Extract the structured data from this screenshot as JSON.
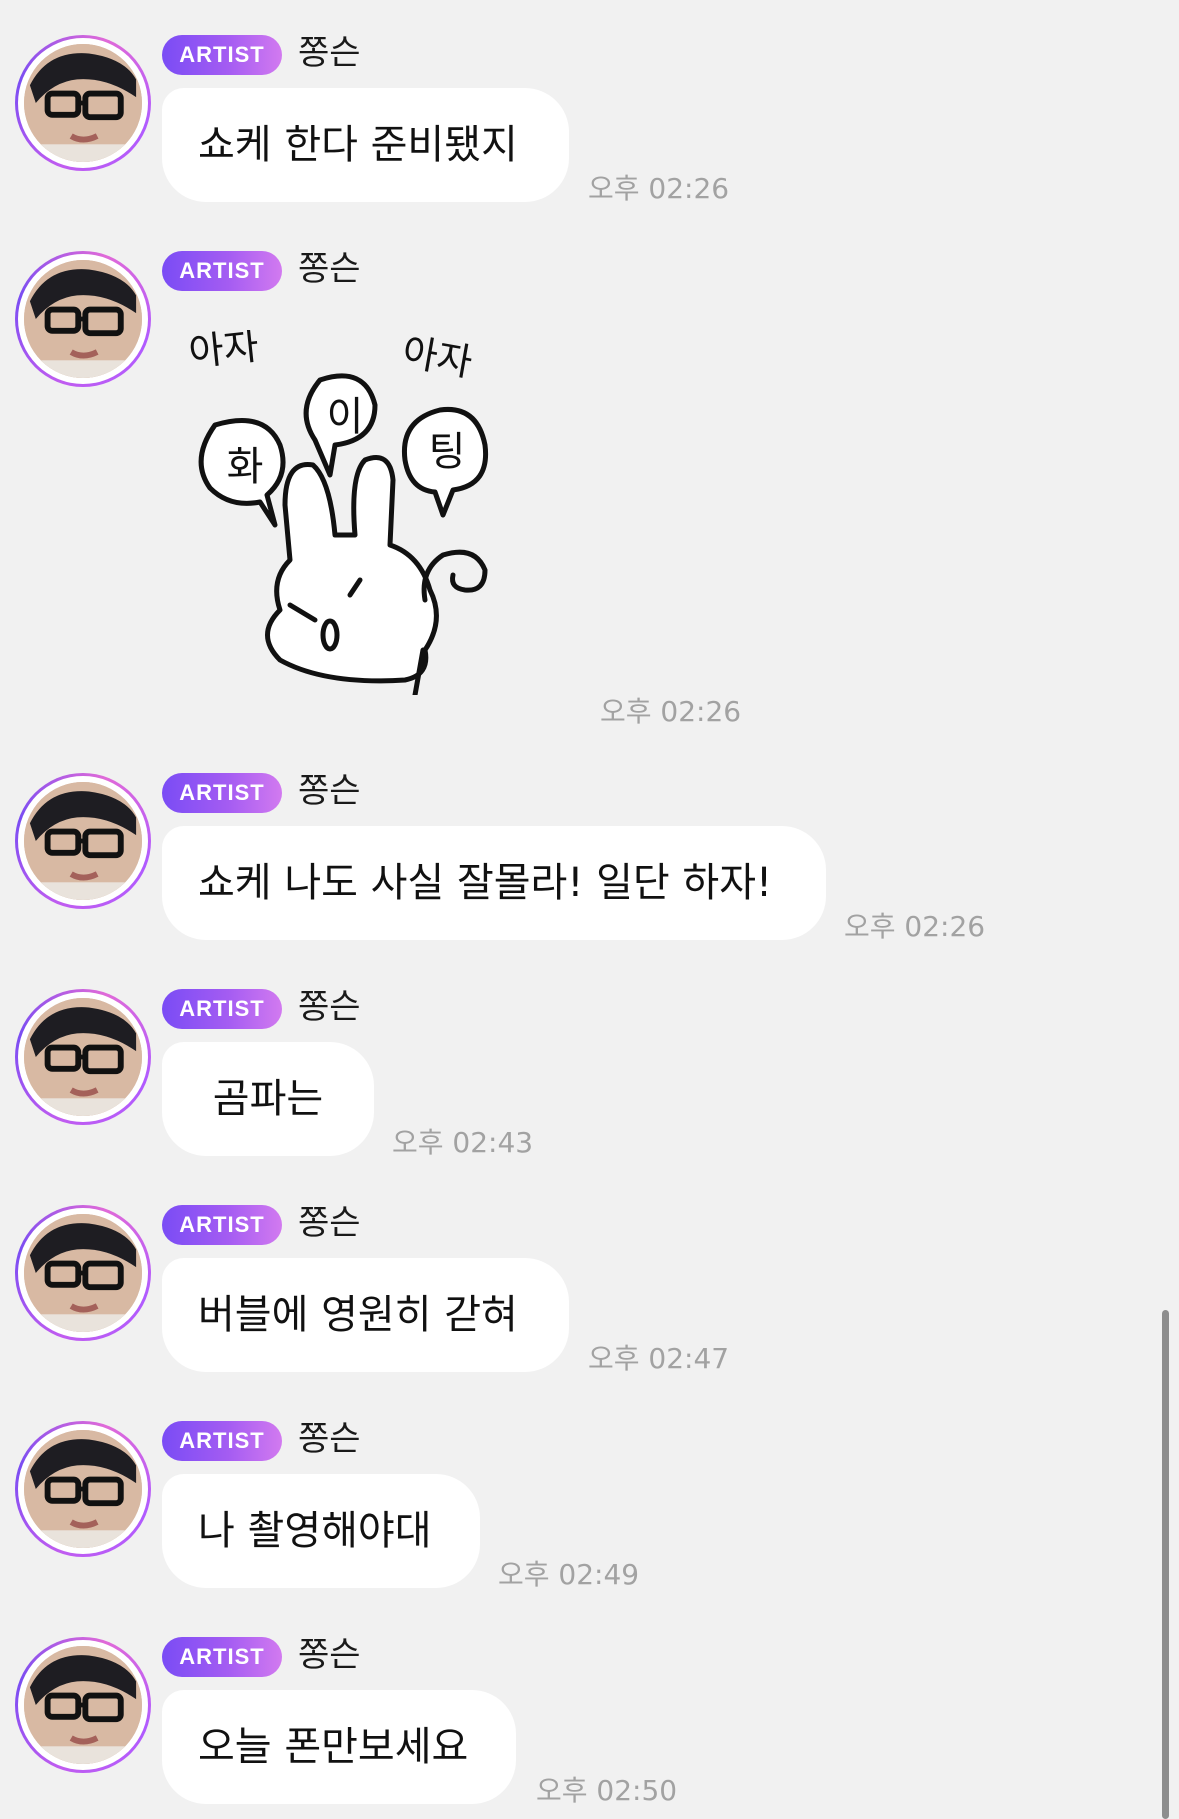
{
  "messages": [
    {
      "badge": "ARTIST",
      "sender": "쫑슨",
      "text": "쇼케 한다 준비됐지",
      "time": "오후 02:26",
      "type": "text"
    },
    {
      "badge": "ARTIST",
      "sender": "쫑슨",
      "time": "오후 02:26",
      "type": "sticker",
      "sticker": {
        "top_left": "아자",
        "top_right": "아자",
        "bubbles": [
          "화",
          "이",
          "팅"
        ]
      }
    },
    {
      "badge": "ARTIST",
      "sender": "쫑슨",
      "text": "쇼케 나도 사실 잘몰라! 일단 하자!",
      "time": "오후 02:26",
      "type": "text"
    },
    {
      "badge": "ARTIST",
      "sender": "쫑슨",
      "text": "곰파는",
      "time": "오후 02:43",
      "type": "text"
    },
    {
      "badge": "ARTIST",
      "sender": "쫑슨",
      "text": "버블에 영원히 갇혀",
      "time": "오후 02:47",
      "type": "text"
    },
    {
      "badge": "ARTIST",
      "sender": "쫑슨",
      "text": "나 촬영해야대",
      "time": "오후 02:49",
      "type": "text"
    },
    {
      "badge": "ARTIST",
      "sender": "쫑슨",
      "text": "오늘 폰만보세요",
      "time": "오후 02:50",
      "type": "text"
    }
  ],
  "colors": {
    "background": "#f1f1f1",
    "bubble": "#ffffff",
    "badge_start": "#7a4cf5",
    "badge_end": "#d27af0",
    "timestamp": "#a2a2a2"
  },
  "icons": {
    "avatar": "artist-avatar",
    "sticker": "rabbit-fighting-sticker"
  }
}
